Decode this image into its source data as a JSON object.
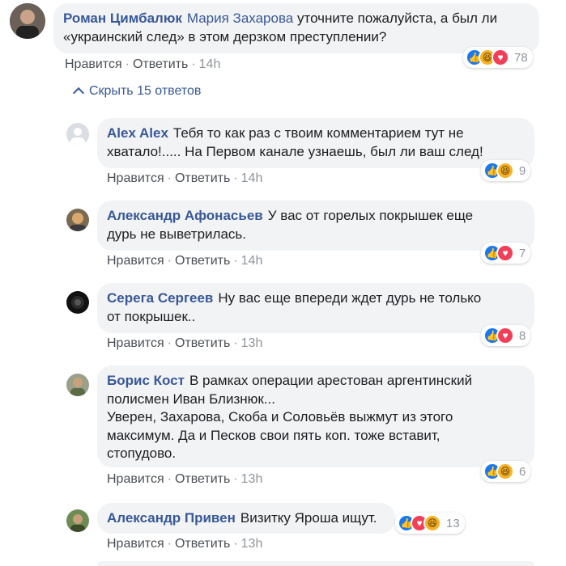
{
  "main_comment": {
    "author": "Роман Цимбалюк",
    "mention": "Мария Захарова",
    "text": " уточните пожалуйста, а был ли\n«украинский след» в этом дерзком преступлении?",
    "like": "Нравится",
    "reply": "Ответить",
    "time": "14h",
    "reaction_count": "78"
  },
  "hide_replies_label": "Скрыть 15 ответов",
  "replies": [
    {
      "author": "Alex Alex",
      "text": "Тебя то как раз с твоим комментарием тут не\nхватало!..... На Первом канале узнаешь, был ли ваш след!",
      "like": "Нравится",
      "reply": "Ответить",
      "time": "14h",
      "reaction_count": "9"
    },
    {
      "author": "Александр Афонасьев",
      "text": "У вас от горелых покрышек еще\nдурь не выветрилась.",
      "like": "Нравится",
      "reply": "Ответить",
      "time": "14h",
      "reaction_count": "7"
    },
    {
      "author": "Серега Сергеев",
      "text": "Ну вас еще впереди ждет дурь не только\nот покрышек..",
      "like": "Нравится",
      "reply": "Ответить",
      "time": "13h",
      "reaction_count": "8"
    },
    {
      "author": "Борис Кост",
      "text": "В рамках операции арестован аргентинский\nполисмен Иван Близнюк...\nУверен, Захарова, Скоба и Соловьёв выжмут из этого\nмаксимум. Да и Песков свои пять коп. тоже вставит,\nстопудово.",
      "like": "Нравится",
      "reply": "Ответить",
      "time": "13h",
      "reaction_count": "6"
    },
    {
      "author": "Александр Привен",
      "text": "Визитку Яроша ищут.",
      "like": "Нравится",
      "reply": "Ответить",
      "time": "13h",
      "reaction_count": "13"
    }
  ],
  "colors": {
    "link": "#385898",
    "bubble": "#f2f3f5",
    "like": "#1877f2",
    "haha": "#f7b125",
    "love": "#f33e58"
  }
}
